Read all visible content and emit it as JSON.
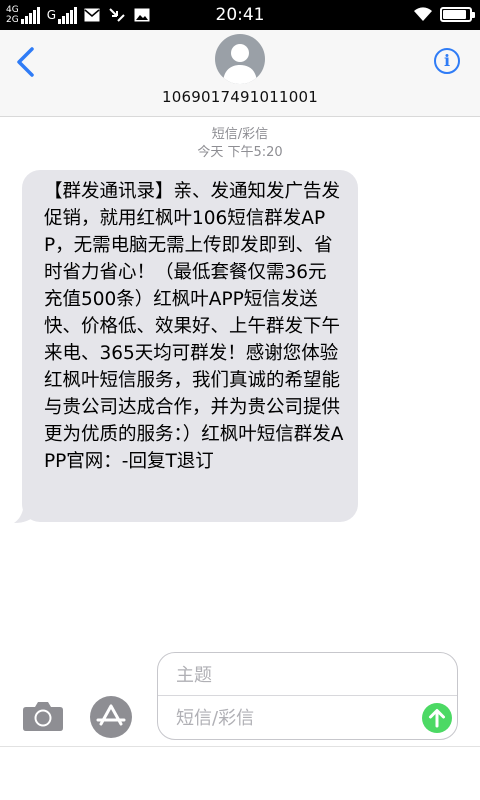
{
  "status_bar": {
    "network1": "4G",
    "network2": "2G",
    "network3": "G",
    "time": "20:41",
    "battery_level": 0.9
  },
  "header": {
    "contact_number": "1069017491011001"
  },
  "conversation": {
    "service_label": "短信/彩信",
    "timestamp": "今天 下午5:20"
  },
  "message": {
    "text": "【群发通讯录】亲、发通知发广告发促销，就用红枫叶106短信群发APP，无需电脑无需上传即发即到、省时省力省心！（最低套餐仅需36元充值500条）红枫叶APP短信发送快、价格低、效果好、上午群发下午来电、365天均可群发！感谢您体验红枫叶短信服务，我们真诚的希望能与贵公司达成合作，并为贵公司提供更为优质的服务：）红枫叶短信群发APP官网：-回复T退订"
  },
  "composer": {
    "subject_placeholder": "主题",
    "message_placeholder": "短信/彩信"
  },
  "icons": {
    "back": "chevron-left-icon",
    "info": "info-icon",
    "camera": "camera-icon",
    "appstore": "app-store-icon",
    "send": "arrow-up-icon"
  },
  "colors": {
    "accent": "#2f7cf6",
    "bubble": "#e5e5ea",
    "send": "#4cd964"
  }
}
